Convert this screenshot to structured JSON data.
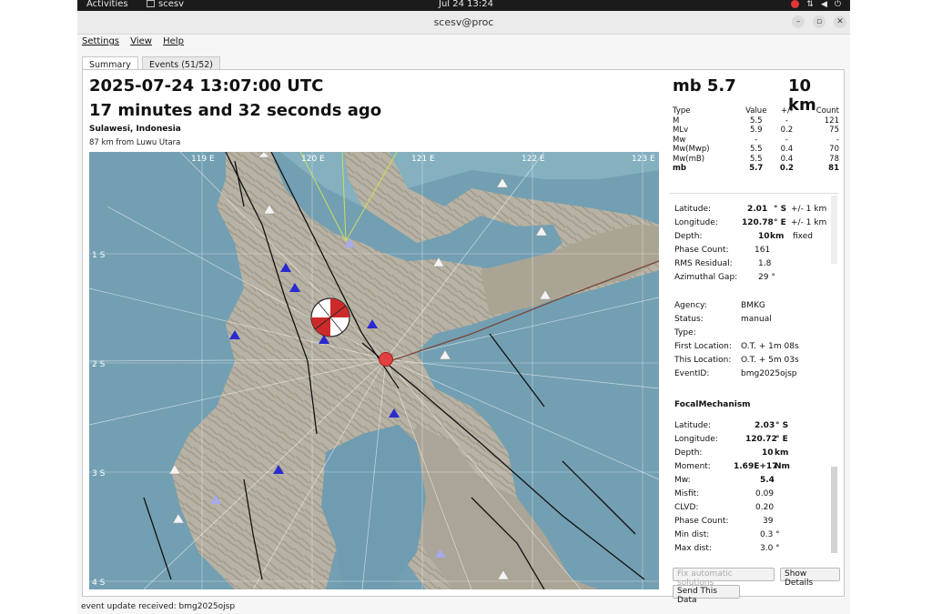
{
  "topbar": {
    "activities": "Activities",
    "app": "scesv",
    "clock": "Jul 24  13:24"
  },
  "window": {
    "title": "scesv@proc"
  },
  "menu": [
    "Settings",
    "View",
    "Help"
  ],
  "tabs": [
    "Summary",
    "Events (51/52)"
  ],
  "event": {
    "time": "2025-07-24 13:07:00 UTC",
    "ago": "17 minutes and 32 seconds ago",
    "region": "Sulawesi, Indonesia",
    "distance": "87 km from Luwu Utara",
    "mag": "mb 5.7",
    "depth": "10 km"
  },
  "magnitudes": {
    "headers": [
      "Type",
      "Value",
      "+/-",
      "Count"
    ],
    "rows": [
      [
        "M",
        "5.5",
        "-",
        "121"
      ],
      [
        "MLv",
        "5.9",
        "0.2",
        "75"
      ],
      [
        "Mw",
        "-",
        "-",
        "-"
      ],
      [
        "Mw(Mwp)",
        "5.5",
        "0.4",
        "70"
      ],
      [
        "Mw(mB)",
        "5.5",
        "0.4",
        "78"
      ],
      [
        "mb",
        "5.7",
        "0.2",
        "81"
      ]
    ]
  },
  "origin": {
    "lat_label": "Latitude:",
    "lat": "2.01",
    "lat_unit": "° S",
    "lat_err": "+/-   1 km",
    "lon_label": "Longitude:",
    "lon": "120.78",
    "lon_unit": "° E",
    "lon_err": "+/-   1 km",
    "depth_label": "Depth:",
    "depth": "10",
    "depth_unit": "km",
    "depth_type": "fixed",
    "phase_label": "Phase Count:",
    "phase": "161",
    "rms_label": "RMS Residual:",
    "rms": "1.8",
    "gap_label": "Azimuthal Gap:",
    "gap": "29  °",
    "agency_label": "Agency:",
    "agency": "BMKG",
    "status_label": "Status:",
    "status": "manual",
    "type_label": "Type:",
    "firstloc_label": "First Location:",
    "firstloc": "O.T. + 1m 08s",
    "thisloc_label": "This Location:",
    "thisloc": "O.T. + 5m 03s",
    "eventid_label": "EventID:",
    "eventid": "bmg2025ojsp"
  },
  "focal": {
    "title": "FocalMechanism",
    "lat_label": "Latitude:",
    "lat": "2.03",
    "lat_unit": "° S",
    "lon_label": "Longitude:",
    "lon": "120.72",
    "lon_unit": "° E",
    "depth_label": "Depth:",
    "depth": "10",
    "depth_unit": "km",
    "moment_label": "Moment:",
    "moment": "1.69E+17",
    "moment_unit": "Nm",
    "mw_label": "Mw:",
    "mw": "5.4",
    "misfit_label": "Misfit:",
    "misfit": "0.09",
    "clvd_label": "CLVD:",
    "clvd": "0.20",
    "phase_label": "Phase Count:",
    "phase": "39",
    "mindist_label": "Min dist:",
    "mindist": "0.3  °",
    "maxdist_label": "Max dist:",
    "maxdist": "3.0  °"
  },
  "buttons": {
    "fix": "Fix automatic solutions",
    "details": "Show Details",
    "send": "Send This Data"
  },
  "map": {
    "lon_labels": [
      "119 E",
      "120 E",
      "121 E",
      "122 E",
      "123 E"
    ],
    "lat_labels": [
      "1 S",
      "2 S",
      "3 S",
      "4 S"
    ]
  },
  "status": "event update received: bmg2025ojsp"
}
